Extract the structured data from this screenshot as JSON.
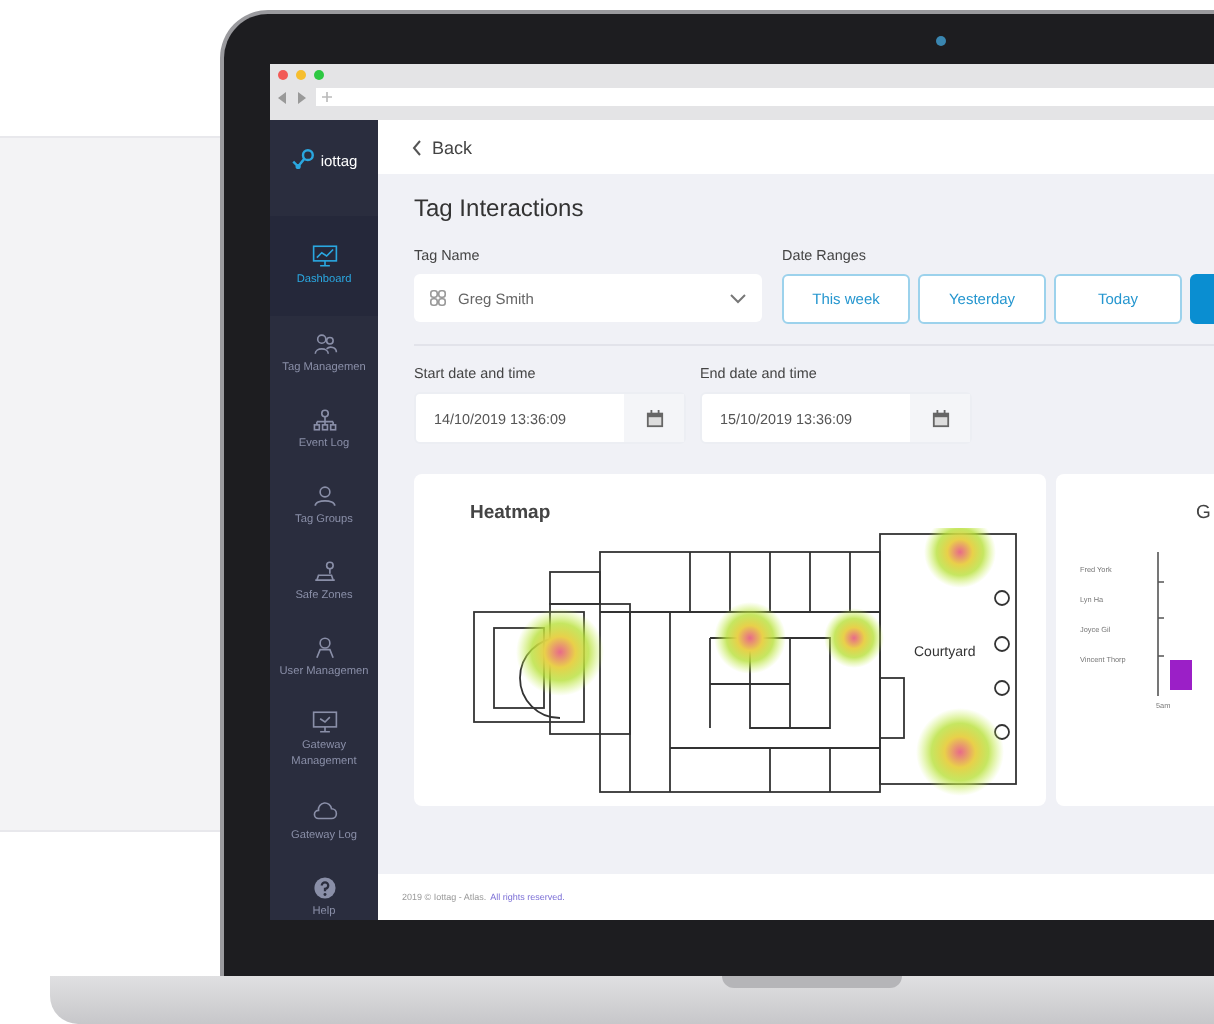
{
  "sidebar": {
    "logo": "iottag",
    "items": [
      {
        "label": "Dashboard",
        "kind": "chart",
        "selected": true
      },
      {
        "label": "Tag Managemen",
        "kind": "tags",
        "selected": false
      },
      {
        "label": "Event Log",
        "kind": "tree",
        "selected": false
      },
      {
        "label": "Tag Groups",
        "kind": "people",
        "selected": false
      },
      {
        "label": "Safe Zones",
        "kind": "zone",
        "selected": false
      },
      {
        "label": "User Managemen",
        "kind": "person",
        "selected": false
      },
      {
        "label": "Gateway Management",
        "kind": "monitor",
        "selected": false
      },
      {
        "label": "Gateway Log",
        "kind": "cloud",
        "selected": false
      },
      {
        "label": "Help",
        "kind": "help",
        "selected": false
      }
    ]
  },
  "header": {
    "back": "Back"
  },
  "title": "Tag Interactions",
  "tag_name": {
    "label": "Tag Name",
    "value": "Greg Smith"
  },
  "date_ranges": {
    "label": "Date Ranges",
    "buttons": [
      {
        "label": "This week",
        "selected": false
      },
      {
        "label": "Yesterday",
        "selected": false
      },
      {
        "label": "Today",
        "selected": false
      },
      {
        "selected": true
      }
    ]
  },
  "start": {
    "label": "Start date and time",
    "value": "14/10/2019 13:36:09"
  },
  "end": {
    "label": "End date and time",
    "value": "15/10/2019 13:36:09"
  },
  "heatmap": {
    "title": "Heatmap",
    "area_label": "Courtyard"
  },
  "graph": {
    "title": "G",
    "rows": [
      "Fred York",
      "Lyn Ha",
      "Joyce Gil",
      "Vincent Thorp"
    ],
    "x_label": "5am"
  },
  "footer": {
    "text": "2019 © Iottag - Atlas.",
    "link": "All rights reserved."
  }
}
